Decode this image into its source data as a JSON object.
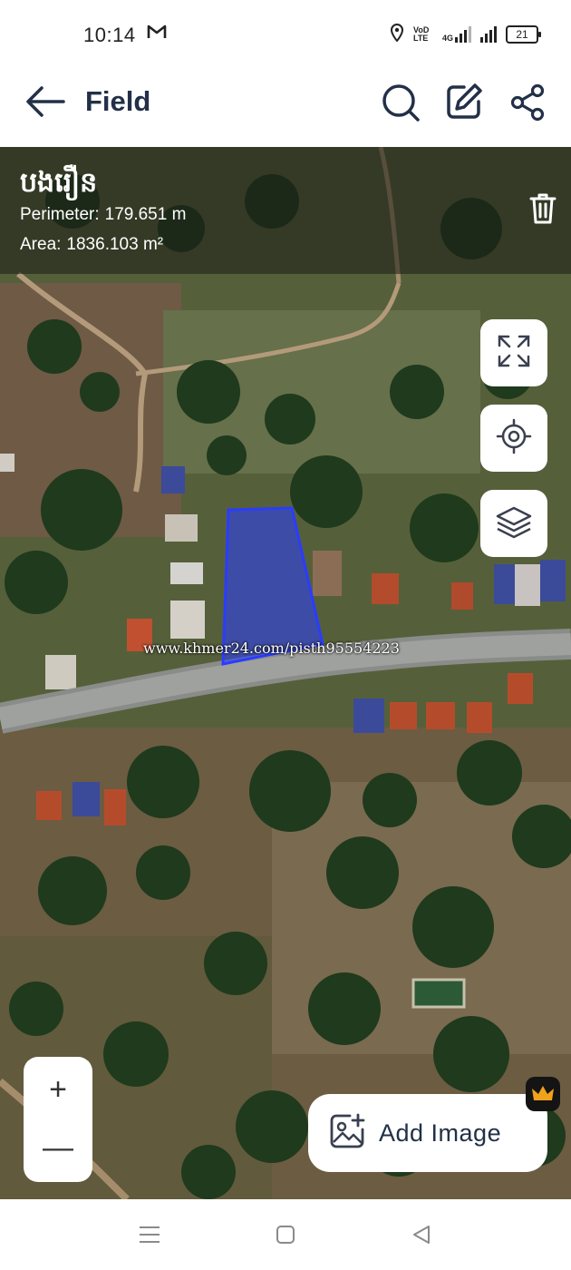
{
  "status_bar": {
    "time": "10:14",
    "notification_icon": "gmail-icon",
    "volte_label": "VoD LTE",
    "network_label": "4G",
    "battery": "21"
  },
  "app_bar": {
    "title": "Field",
    "icons": [
      "back-arrow-icon",
      "search-icon",
      "edit-icon",
      "share-icon"
    ]
  },
  "field": {
    "name": "បងរឿន",
    "perimeter_label": "Perimeter:",
    "perimeter_value": "179.651 m",
    "area_label": "Area:",
    "area_value": "1836.103 m²"
  },
  "map": {
    "watermark": "www.khmer24.com/pisth95554223",
    "polygon_color": "#2a3cff",
    "controls": [
      "fullscreen-icon",
      "locate-icon",
      "layers-icon"
    ]
  },
  "zoom": {
    "plus": "+",
    "minus": "—"
  },
  "add_image": {
    "label": "Add Image",
    "badge_icon": "crown-icon"
  },
  "nav_bar": {
    "icons": [
      "recents-icon",
      "home-icon",
      "back-icon"
    ]
  },
  "colors": {
    "accent": "#223048",
    "field_fill": "#2a3cff"
  }
}
